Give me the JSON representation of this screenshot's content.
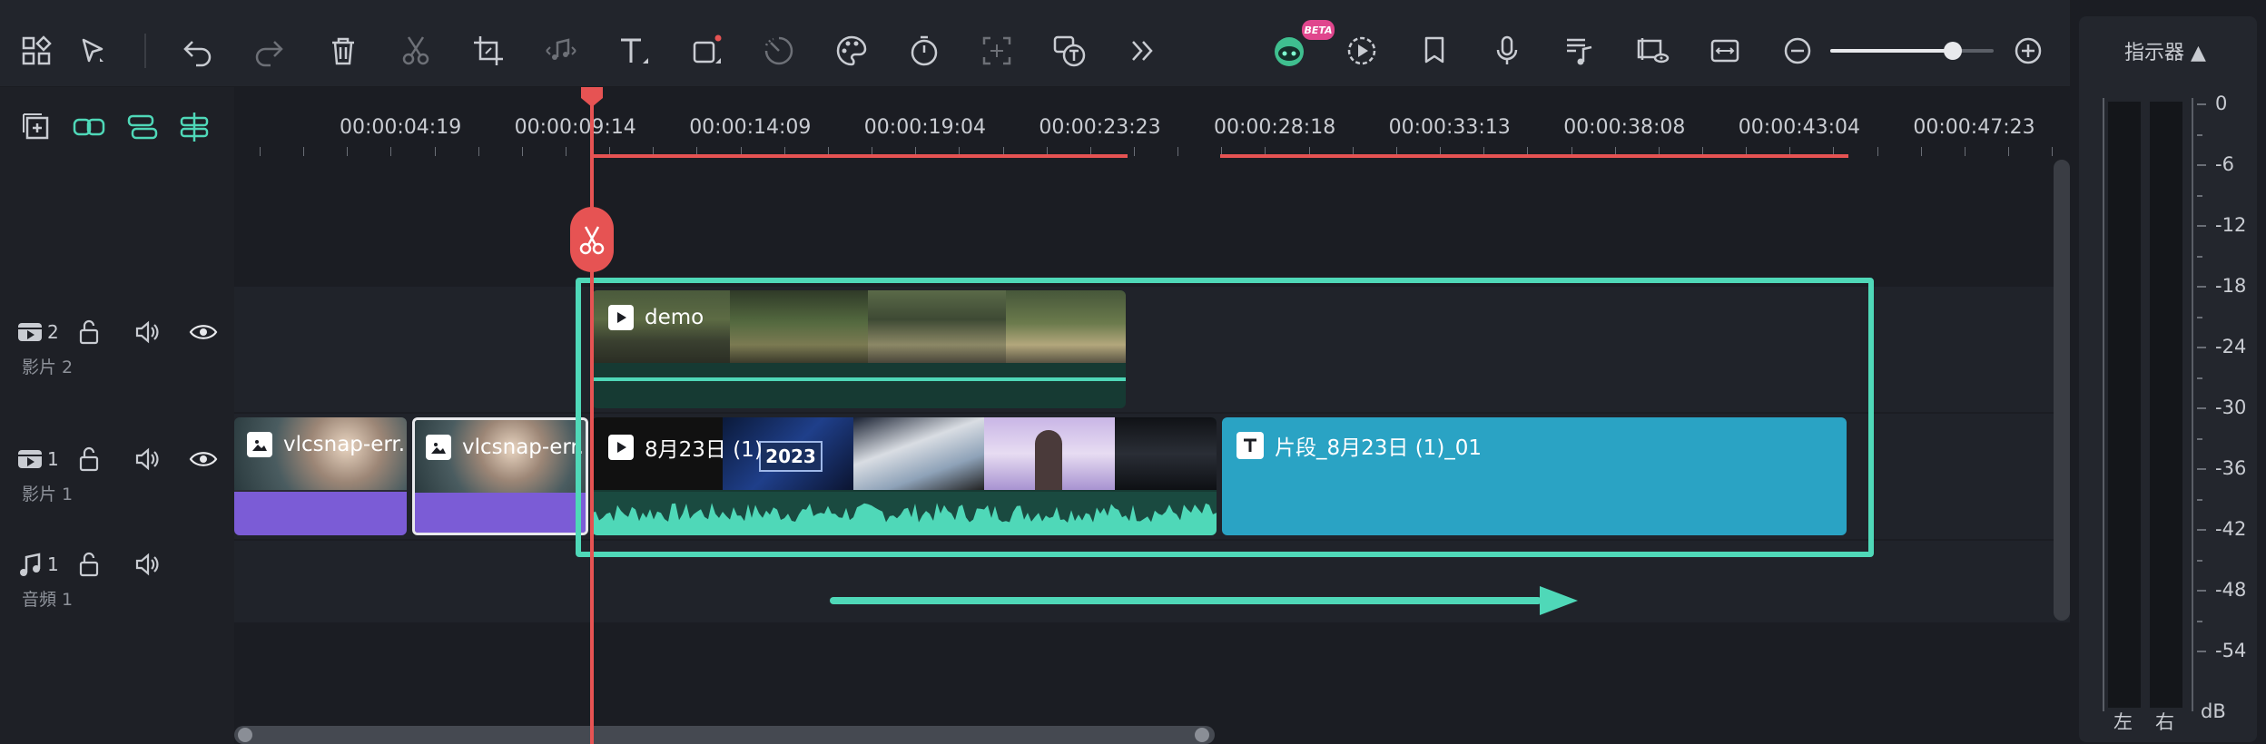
{
  "toolbar": {
    "left_icons": [
      "layout-icon",
      "select-arrow-icon",
      "undo-icon",
      "redo-icon",
      "delete-icon",
      "cut-icon",
      "crop-icon",
      "audio-detach-icon",
      "text-icon",
      "shape-icon",
      "speed-icon",
      "color-icon",
      "duration-icon",
      "ai-portrait-icon",
      "speech-to-text-icon",
      "more-icon"
    ],
    "right_icons": [
      "ai-copilot-icon",
      "render-preview-icon",
      "marker-icon",
      "voiceover-icon",
      "music-icon",
      "snapshot-icon",
      "fit-icon",
      "zoom-out-icon",
      "zoom-in-icon"
    ],
    "beta_badge": "BETA",
    "zoom_level": 0.75
  },
  "track_tools": [
    "add-track-icon",
    "link-icon",
    "split-icon",
    "magnetic-icon"
  ],
  "ruler": {
    "timecodes": [
      "00:00:04:19",
      "00:00:09:14",
      "00:00:14:09",
      "00:00:19:04",
      "00:00:23:23",
      "00:00:28:18",
      "00:00:33:13",
      "00:00:38:08",
      "00:00:43:04",
      "00:00:47:23"
    ],
    "playhead_time": "00:00:09:14"
  },
  "tracks": [
    {
      "id": "video2",
      "num": "2",
      "label": "影片 2",
      "kind": "video"
    },
    {
      "id": "video1",
      "num": "1",
      "label": "影片 1",
      "kind": "video"
    },
    {
      "id": "audio1",
      "num": "1",
      "label": "音頻 1",
      "kind": "audio"
    }
  ],
  "clips": {
    "demo": "demo",
    "vic1": "vlcsnap-err...",
    "vic2": "vlcsnap-err...",
    "aug": "8月23日 (1)",
    "title_clip": "片段_8月23日 (1)_01",
    "badge_2023": "2023"
  },
  "meter": {
    "title": "指示器 ▲",
    "db_values": [
      "0",
      "-6",
      "-12",
      "-18",
      "-24",
      "-30",
      "-36",
      "-42",
      "-48",
      "-54",
      "dB"
    ],
    "left": "左",
    "right": "右"
  },
  "colors": {
    "accent": "#4fd8b8",
    "playhead": "#e65353",
    "video_clip_bar": "#7b5cd6",
    "title_clip": "#2aa3c4"
  }
}
